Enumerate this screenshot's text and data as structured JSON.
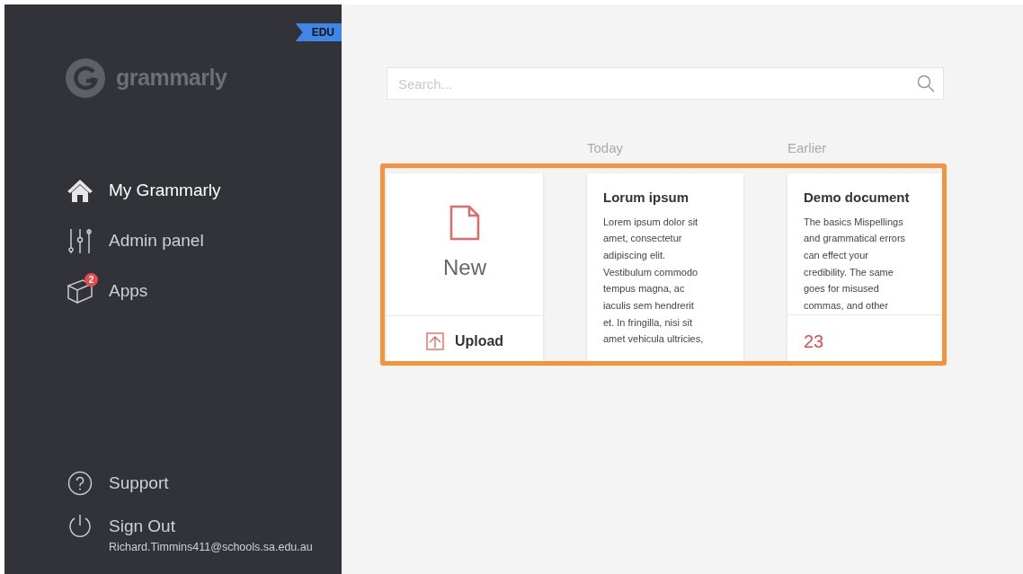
{
  "sidebar": {
    "badge": "EDU",
    "logo": "grammarly",
    "nav": [
      {
        "label": "My Grammarly",
        "selected": true
      },
      {
        "label": "Admin panel",
        "selected": false
      },
      {
        "label": "Apps",
        "selected": false,
        "count": "2"
      }
    ],
    "footer": [
      {
        "label": "Support"
      },
      {
        "label": "Sign Out",
        "sub": "Richard.Timmins411@schools.sa.edu.au"
      }
    ]
  },
  "search": {
    "placeholder": "Search..."
  },
  "groups": [
    {
      "label": "Today"
    },
    {
      "label": "Earlier"
    }
  ],
  "new_card": {
    "label": "New",
    "upload": "Upload"
  },
  "highlighted": true,
  "documents": [
    {
      "title": "Lorum ipsum",
      "lines": [
        "Lorem ipsum dolor sit",
        "amet, consectetur",
        "adipiscing elit.",
        "Vestibulum commodo",
        "tempus magna, ac",
        "iaculis sem hendrerit",
        "et. In fringilla, nisi sit",
        "amet vehicula ultricies,"
      ]
    },
    {
      "title": "Demo document",
      "lines": [
        "The basics Mispellings",
        "and grammatical errors",
        "can effect your",
        "credibility. The same",
        "goes for misused",
        "commas, and other"
      ],
      "score": "23"
    }
  ]
}
